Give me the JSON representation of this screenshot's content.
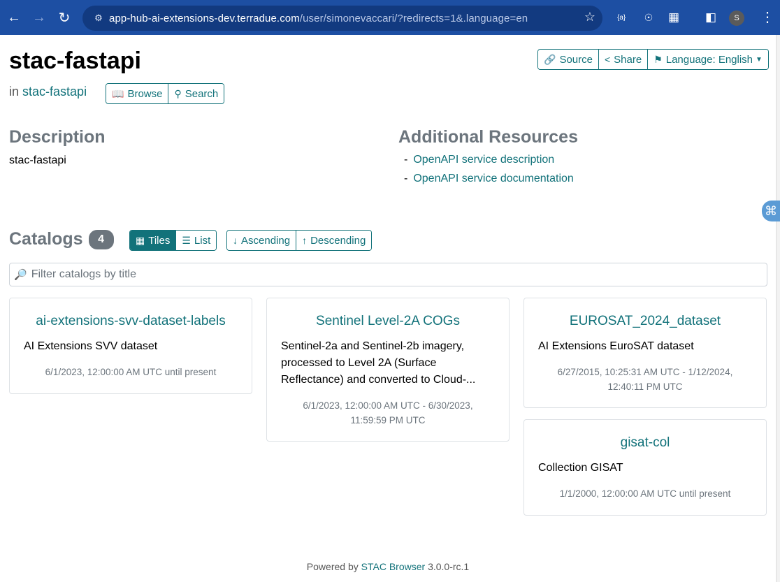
{
  "browser": {
    "url_host": "app-hub-ai-extensions-dev.terradue.com",
    "url_path": "/user/simonevaccari/?redirects=1&.language=en",
    "profile_initial": "S",
    "ext_label": "{a}"
  },
  "header": {
    "title": "stac-fastapi",
    "in_prefix": "in",
    "parent_link": "stac-fastapi",
    "browse_label": "Browse",
    "search_label": "Search",
    "source_label": "Source",
    "share_label": "Share",
    "language_label": "Language: English"
  },
  "description": {
    "heading": "Description",
    "text": "stac-fastapi"
  },
  "resources": {
    "heading": "Additional Resources",
    "items": [
      {
        "dash": "-",
        "label": "OpenAPI service description"
      },
      {
        "dash": "-",
        "label": "OpenAPI service documentation"
      }
    ]
  },
  "catalogs": {
    "heading": "Catalogs",
    "count": "4",
    "tiles_label": "Tiles",
    "list_label": "List",
    "ascending_label": "Ascending",
    "descending_label": "Descending",
    "filter_placeholder": "Filter catalogs by title",
    "items": [
      {
        "title": "ai-extensions-svv-dataset-labels",
        "description": "AI Extensions SVV dataset",
        "temporal": "6/1/2023, 12:00:00 AM UTC until present"
      },
      {
        "title": "Sentinel Level-2A COGs",
        "description": "Sentinel-2a and Sentinel-2b imagery, processed to Level 2A (Surface Reflectance) and converted to Cloud-...",
        "temporal": "6/1/2023, 12:00:00 AM UTC - 6/30/2023, 11:59:59 PM UTC"
      },
      {
        "title": "EUROSAT_2024_dataset",
        "description": "AI Extensions EuroSAT dataset",
        "temporal": "6/27/2015, 10:25:31 AM UTC - 1/12/2024, 12:40:11 PM UTC"
      },
      {
        "title": "gisat-col",
        "description": "Collection GISAT",
        "temporal": "1/1/2000, 12:00:00 AM UTC until present"
      }
    ]
  },
  "footer": {
    "prefix": "Powered by",
    "link": "STAC Browser",
    "version": "3.0.0-rc.1"
  }
}
